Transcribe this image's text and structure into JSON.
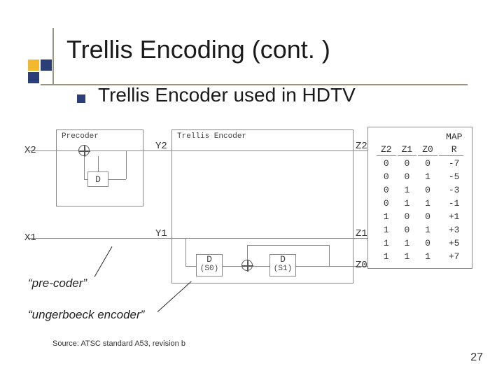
{
  "title": "Trellis Encoding (cont. )",
  "bullet": "Trellis Encoder used in HDTV",
  "annotations": {
    "precoder": "“pre-coder”",
    "ungerboeck": "“ungerboeck encoder”"
  },
  "diagram": {
    "precoder_label": "Precoder",
    "trellis_label": "Trellis Encoder",
    "map_label": "MAP",
    "inputs": {
      "x2": "X2",
      "x1": "X1"
    },
    "mid": {
      "y2": "Y2",
      "y1": "Y1"
    },
    "outputs": {
      "z2": "Z2",
      "z1": "Z1",
      "z0": "Z0"
    },
    "delay": "D",
    "s0": "(S0)",
    "s1": "(S1)",
    "xor": "X"
  },
  "map_table": {
    "headers": [
      "Z2",
      "Z1",
      "Z0",
      "R"
    ],
    "rows": [
      [
        "0",
        "0",
        "0",
        "-7"
      ],
      [
        "0",
        "0",
        "1",
        "-5"
      ],
      [
        "0",
        "1",
        "0",
        "-3"
      ],
      [
        "0",
        "1",
        "1",
        "-1"
      ],
      [
        "1",
        "0",
        "0",
        "+1"
      ],
      [
        "1",
        "0",
        "1",
        "+3"
      ],
      [
        "1",
        "1",
        "0",
        "+5"
      ],
      [
        "1",
        "1",
        "1",
        "+7"
      ]
    ]
  },
  "source": "Source: ATSC standard A53, revision b",
  "page": "27",
  "colors": {
    "accent1": "#f2b82e",
    "accent2": "#2b3e78",
    "rule": "#9a9582"
  }
}
